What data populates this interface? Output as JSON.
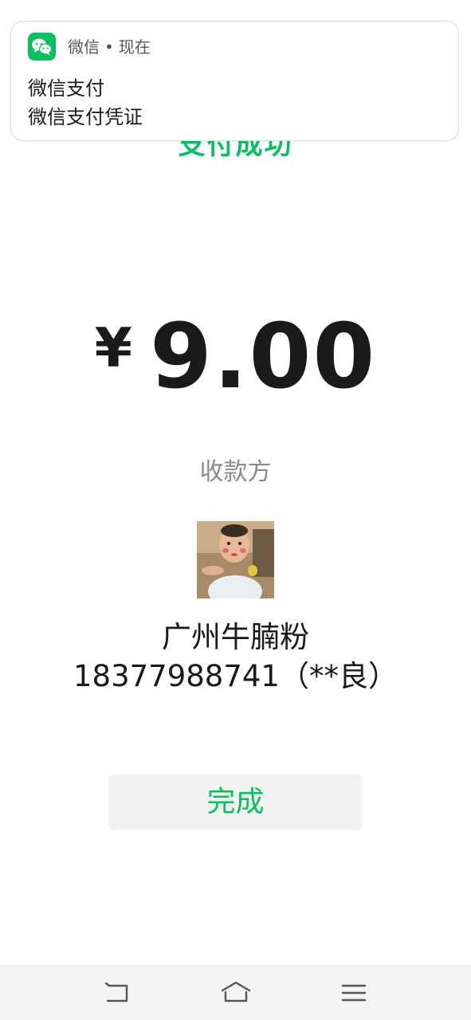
{
  "notification": {
    "app_name": "微信",
    "separator": "•",
    "time": "现在",
    "title": "微信支付",
    "body": "微信支付凭证",
    "icon": "wechat-icon"
  },
  "payment": {
    "status_title": "支付成功",
    "currency_symbol": "¥",
    "amount": "9.00",
    "payee_label": "收款方",
    "payee_name": "广州牛腩粉",
    "payee_account": "18377988741（**良）"
  },
  "actions": {
    "done_label": "完成"
  },
  "system_nav": {
    "back_icon": "back-icon",
    "home_icon": "home-icon",
    "menu_icon": "menu-icon"
  },
  "colors": {
    "accent": "#07c160",
    "text": "#1a1a1a",
    "muted": "#8a8a8a",
    "button_bg": "#f2f2f2",
    "nav_bg": "#f4f4f4"
  }
}
